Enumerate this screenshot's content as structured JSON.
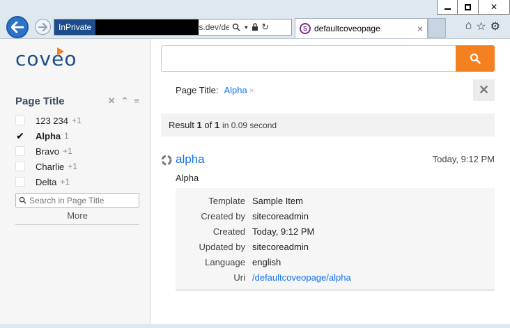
{
  "browser": {
    "inprivate_label": "InPrivate",
    "address_text": "s.dev/defau",
    "tab_title": "defaultcoveopage",
    "tab_favicon_letter": "S",
    "tab_close": "×"
  },
  "sidebar": {
    "logo_text": "coveo",
    "facet": {
      "title": "Page Title",
      "values": [
        {
          "label": "123 234",
          "count": "+1",
          "selected": false
        },
        {
          "label": "Alpha",
          "count": "1",
          "selected": true
        },
        {
          "label": "Bravo",
          "count": "+1",
          "selected": false
        },
        {
          "label": "Charlie",
          "count": "+1",
          "selected": false
        },
        {
          "label": "Delta",
          "count": "+1",
          "selected": false
        }
      ],
      "search_placeholder": "Search in Page Title",
      "more_label": "More"
    }
  },
  "search": {
    "query": "",
    "button_color": "#f58020"
  },
  "breadcrumb": {
    "field": "Page Title:",
    "value": "Alpha",
    "remove": "×"
  },
  "summary": {
    "prefix": "Result",
    "first": "1",
    "of": "of",
    "total": "1",
    "duration": "in 0.09 second"
  },
  "result": {
    "title": "alpha",
    "date": "Today, 9:12 PM",
    "excerpt": "Alpha",
    "fields": [
      {
        "name": "Template",
        "value": "Sample Item",
        "link": false
      },
      {
        "name": "Created by",
        "value": "sitecoreadmin",
        "link": false
      },
      {
        "name": "Created",
        "value": "Today, 9:12 PM",
        "link": false
      },
      {
        "name": "Updated by",
        "value": "sitecoreadmin",
        "link": false
      },
      {
        "name": "Language",
        "value": "english",
        "link": false
      },
      {
        "name": "Uri",
        "value": "/defaultcoveopage/alpha",
        "link": true
      }
    ]
  },
  "colors": {
    "accent": "#f58020",
    "link": "#1372ec",
    "brand": "#1c4e8a"
  }
}
